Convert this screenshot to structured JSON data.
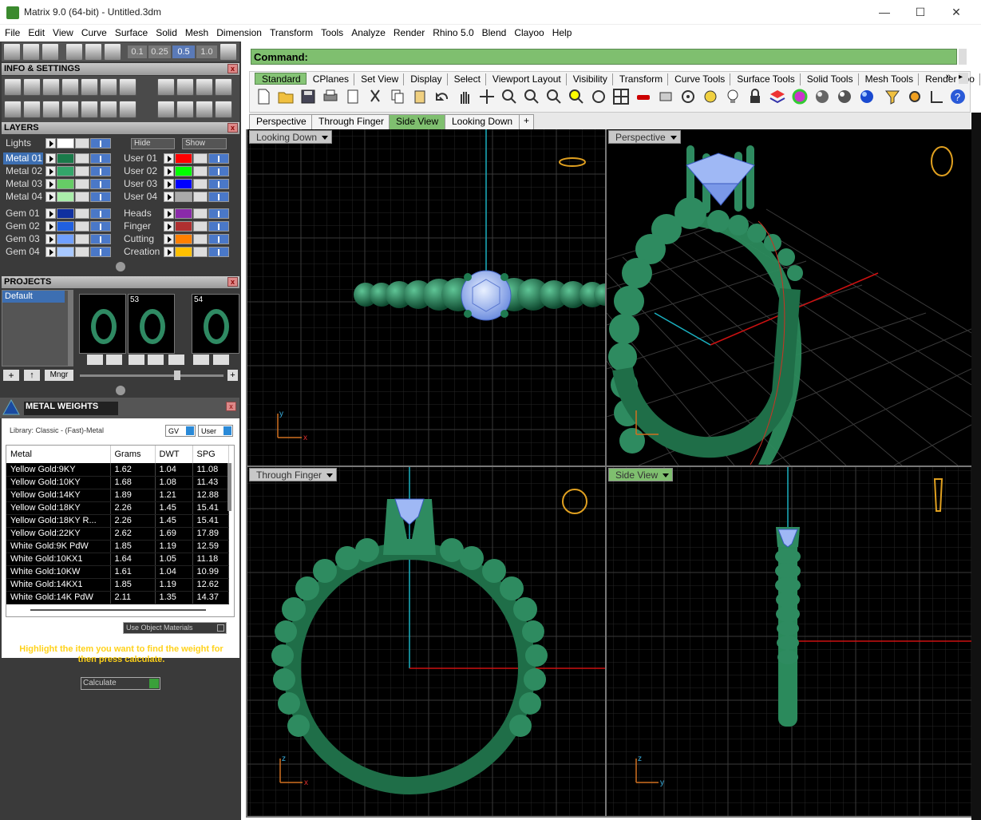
{
  "window": {
    "title": "Matrix 9.0 (64-bit) - Untitled.3dm",
    "minimize": "—",
    "maximize": "☐",
    "close": "✕"
  },
  "menu": [
    "File",
    "Edit",
    "View",
    "Curve",
    "Surface",
    "Solid",
    "Mesh",
    "Dimension",
    "Transform",
    "Tools",
    "Analyze",
    "Render",
    "Rhino 5.0",
    "Blend",
    "Clayoo",
    "Help"
  ],
  "snap_values": [
    "0.1",
    "0.25",
    "0.5",
    "1.0"
  ],
  "panels": {
    "info": "INFO & SETTINGS",
    "layers": "LAYERS",
    "projects": "PROJECTS",
    "metal": "METAL WEIGHTS"
  },
  "layers": {
    "hide": "Hide",
    "show": "Show",
    "left": [
      {
        "name": "Lights",
        "color": "#ffffff"
      },
      {
        "name": "Metal 01",
        "color": "#1a7a4a",
        "selected": true
      },
      {
        "name": "Metal 02",
        "color": "#33a66a"
      },
      {
        "name": "Metal 03",
        "color": "#66cc66"
      },
      {
        "name": "Metal 04",
        "color": "#aaeeaa"
      },
      {
        "name": "Gem 01",
        "color": "#1030a0"
      },
      {
        "name": "Gem 02",
        "color": "#2060e0"
      },
      {
        "name": "Gem 03",
        "color": "#70a0ff"
      },
      {
        "name": "Gem 04",
        "color": "#a8c8ff"
      }
    ],
    "right": [
      {
        "name": "User 01",
        "color": "#ff0000"
      },
      {
        "name": "User 02",
        "color": "#00ff00"
      },
      {
        "name": "User 03",
        "color": "#0000ff"
      },
      {
        "name": "User 04",
        "color": "#aaaaaa"
      },
      {
        "name": "Heads",
        "color": "#8a2aaa"
      },
      {
        "name": "Finger",
        "color": "#b03030"
      },
      {
        "name": "Cutting",
        "color": "#ff8000"
      },
      {
        "name": "Creation",
        "color": "#ffc000"
      }
    ]
  },
  "projects": {
    "default": "Default",
    "thumbs": [
      "",
      "53",
      "54"
    ],
    "mngr": "Mngr"
  },
  "metal_weights": {
    "library": "Library: Classic - (Fast)-Metal",
    "gv": "GV",
    "user": "User",
    "columns": [
      "Metal",
      "Grams",
      "DWT",
      "SPG"
    ],
    "rows": [
      [
        "Yellow Gold:9KY",
        "1.62",
        "1.04",
        "11.08"
      ],
      [
        "Yellow Gold:10KY",
        "1.68",
        "1.08",
        "11.43"
      ],
      [
        "Yellow Gold:14KY",
        "1.89",
        "1.21",
        "12.88"
      ],
      [
        "Yellow Gold:18KY",
        "2.26",
        "1.45",
        "15.41"
      ],
      [
        "Yellow Gold:18KY R...",
        "2.26",
        "1.45",
        "15.41"
      ],
      [
        "Yellow Gold:22KY",
        "2.62",
        "1.69",
        "17.89"
      ],
      [
        "White Gold:9K PdW",
        "1.85",
        "1.19",
        "12.59"
      ],
      [
        "White Gold:10KX1",
        "1.64",
        "1.05",
        "11.18"
      ],
      [
        "White Gold:10KW",
        "1.61",
        "1.04",
        "10.99"
      ],
      [
        "White Gold:14KX1",
        "1.85",
        "1.19",
        "12.62"
      ],
      [
        "White Gold:14K PdW",
        "2.11",
        "1.35",
        "14.37"
      ]
    ],
    "use_object_materials": "Use Object Materials",
    "hint": "Highlight the item you want to find the weight for then press calculate.",
    "calculate": "Calculate"
  },
  "command": {
    "label": "Command:"
  },
  "toolbar_tabs": [
    "Standard",
    "CPlanes",
    "Set View",
    "Display",
    "Select",
    "Viewport Layout",
    "Visibility",
    "Transform",
    "Curve Tools",
    "Surface Tools",
    "Solid Tools",
    "Mesh Tools",
    "Render Too"
  ],
  "view_tabs": [
    "Perspective",
    "Through Finger",
    "Side View",
    "Looking Down",
    "+"
  ],
  "viewports": {
    "tl": "Looking Down",
    "tr": "Perspective",
    "bl": "Through Finger",
    "br": "Side View"
  },
  "axes": {
    "x": "x",
    "y": "y",
    "z": "z"
  },
  "colors": {
    "metal": "#2e8b60",
    "gem": "#9fb8f5",
    "axis_red": "#cc1111",
    "axis_cyan": "#1ab0c0",
    "ui_green": "#7fbf6f"
  }
}
